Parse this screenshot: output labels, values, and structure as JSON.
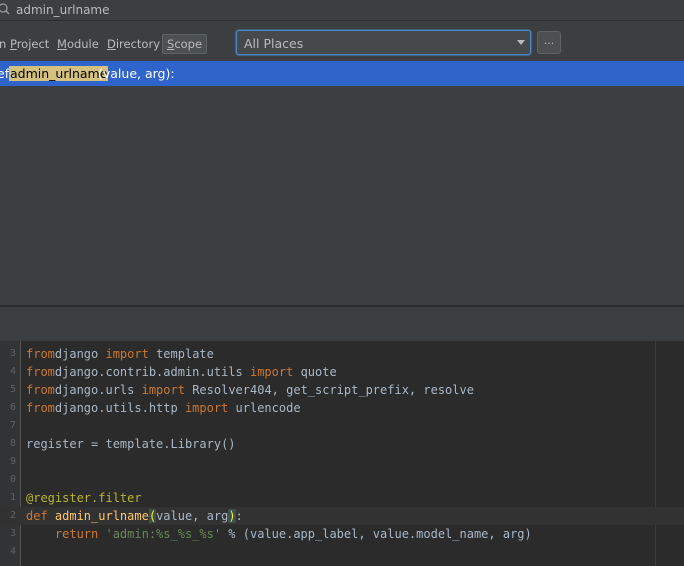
{
  "search": {
    "query": "admin_urlname"
  },
  "scope_options": [
    {
      "label": "n Project",
      "key": "P",
      "pre": "n ",
      "post": "roject"
    },
    {
      "label": "Module",
      "key": "M",
      "pre": "",
      "post": "odule"
    },
    {
      "label": "Directory",
      "key": "D",
      "pre": "",
      "post": "irectory"
    },
    {
      "label": "Scope",
      "key": "S",
      "pre": "",
      "post": "cope"
    }
  ],
  "places_select": {
    "value": "All Places"
  },
  "more_button": {
    "label": "..."
  },
  "result": {
    "prefix": "ef ",
    "match": "admin_urlname",
    "suffix": "(value, arg):"
  },
  "editor": {
    "lines": [
      {
        "num": "3",
        "tokens": [
          [
            "kw",
            "from"
          ],
          [
            "",
            "django "
          ],
          [
            "kw",
            "import"
          ],
          [
            "",
            " template"
          ]
        ]
      },
      {
        "num": "4",
        "tokens": [
          [
            "kw",
            "from"
          ],
          [
            "",
            "django.contrib.admin.utils "
          ],
          [
            "kw",
            "import"
          ],
          [
            "",
            " quote"
          ]
        ]
      },
      {
        "num": "5",
        "tokens": [
          [
            "kw",
            "from"
          ],
          [
            "",
            "django.urls "
          ],
          [
            "kw",
            "import"
          ],
          [
            "",
            " Resolver404, get_script_prefix, resolve"
          ]
        ]
      },
      {
        "num": "6",
        "tokens": [
          [
            "kw",
            "from"
          ],
          [
            "",
            "django.utils.http "
          ],
          [
            "kw",
            "import"
          ],
          [
            "",
            " urlencode"
          ]
        ]
      },
      {
        "num": "7",
        "tokens": []
      },
      {
        "num": "8",
        "tokens": [
          [
            "",
            "register = template.Library()"
          ]
        ]
      },
      {
        "num": "9",
        "tokens": []
      },
      {
        "num": "0",
        "tokens": []
      },
      {
        "num": "1",
        "tokens": [
          [
            "deco",
            "@register.filter"
          ]
        ]
      },
      {
        "num": "2",
        "caret": true,
        "tokens": [
          [
            "kw",
            "def "
          ],
          [
            "fn",
            "admin_urlname"
          ],
          [
            "paren",
            "("
          ],
          [
            "",
            "value, arg"
          ],
          [
            "paren",
            ")"
          ],
          [
            "",
            ":"
          ]
        ]
      },
      {
        "num": "3",
        "tokens": [
          [
            "",
            "    "
          ],
          [
            "kw",
            "return "
          ],
          [
            "str",
            "'admin:%s_%s_%s'"
          ],
          [
            "",
            " % (value.app_label, value.model_name, arg)"
          ]
        ]
      },
      {
        "num": "4",
        "tokens": []
      }
    ]
  }
}
